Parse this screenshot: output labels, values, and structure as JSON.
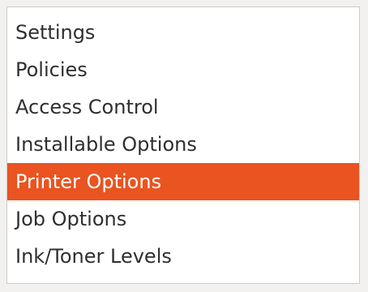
{
  "theme": {
    "selection_color": "#e95420",
    "selection_text_color": "#ffffff",
    "text_color": "#2f2f2f",
    "panel_background": "#ffffff",
    "window_background": "#f2f1f0"
  },
  "options_list": {
    "selected_index": 4,
    "items": [
      {
        "label": "Settings"
      },
      {
        "label": "Policies"
      },
      {
        "label": "Access Control"
      },
      {
        "label": "Installable Options"
      },
      {
        "label": "Printer Options"
      },
      {
        "label": "Job Options"
      },
      {
        "label": "Ink/Toner Levels"
      }
    ]
  }
}
